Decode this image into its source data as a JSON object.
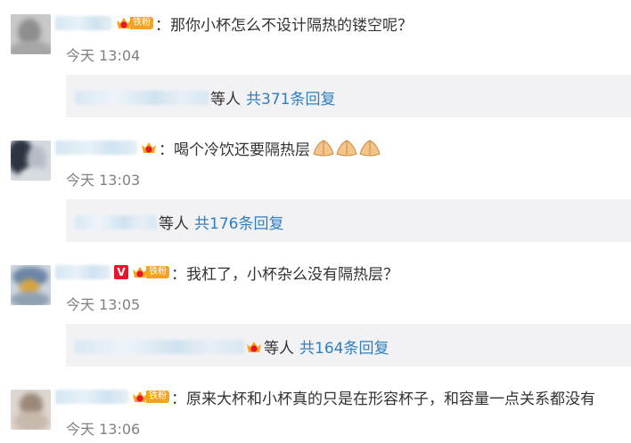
{
  "comments": [
    {
      "separator": "：",
      "text": "那你小杯怎么不设计隔热的镂空呢？",
      "badge_level": "4",
      "fan_label": "铁粉",
      "time": "今天 13:04",
      "reply_suffix": "等人",
      "reply_count": "共371条回复"
    },
    {
      "separator": "：",
      "text": "喝个冷饮还要隔热层",
      "badge_level": "6",
      "time": "今天 13:03",
      "reply_suffix": "等人",
      "reply_count": "共176条回复"
    },
    {
      "separator": "：",
      "text": "我杠了，小杯杂么没有隔热层？",
      "verified": "V",
      "badge_level": "6",
      "fan_label": "铁粉",
      "time": "今天 13:05",
      "reply_suffix": "等人",
      "reply_count": "共164条回复"
    },
    {
      "separator": "：",
      "text": "原来大杯和小杯真的只是在形容杯子，和容量一点关系都没有",
      "badge_level": "1",
      "fan_label": "铁粉",
      "time": "今天 13:06"
    }
  ],
  "colors": {
    "link": "#2e7fc2",
    "time": "#808080",
    "reply_bg": "#f2f2f5",
    "fan_badge": "#f4a224",
    "verified_badge": "#e6162d"
  },
  "icons": [
    "crown-level-icon",
    "fan-badge-icon",
    "verified-v-icon",
    "pray-hands-icon"
  ]
}
